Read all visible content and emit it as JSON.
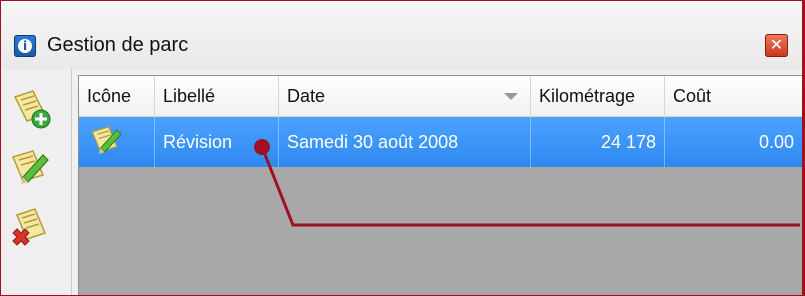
{
  "window": {
    "title": "Gestion de parc"
  },
  "toolbar": {
    "buttons": [
      {
        "name": "add-entry-button",
        "icon": "notepad-add-icon"
      },
      {
        "name": "edit-entry-button",
        "icon": "notepad-edit-icon"
      },
      {
        "name": "delete-entry-button",
        "icon": "notepad-delete-icon"
      }
    ]
  },
  "grid": {
    "columns": [
      "Icône",
      "Libellé",
      "Date",
      "Kilométrage",
      "Coût"
    ],
    "rows": [
      {
        "icon": "notepad-edit-icon",
        "libelle": "Révision",
        "date": "Samedi 30 août 2008",
        "kilometrage": "24 178",
        "cout": "0.00",
        "selected": true
      }
    ]
  },
  "colors": {
    "accent": "#a01020",
    "selection": "#3b95f7",
    "close": "#d84a2b"
  }
}
